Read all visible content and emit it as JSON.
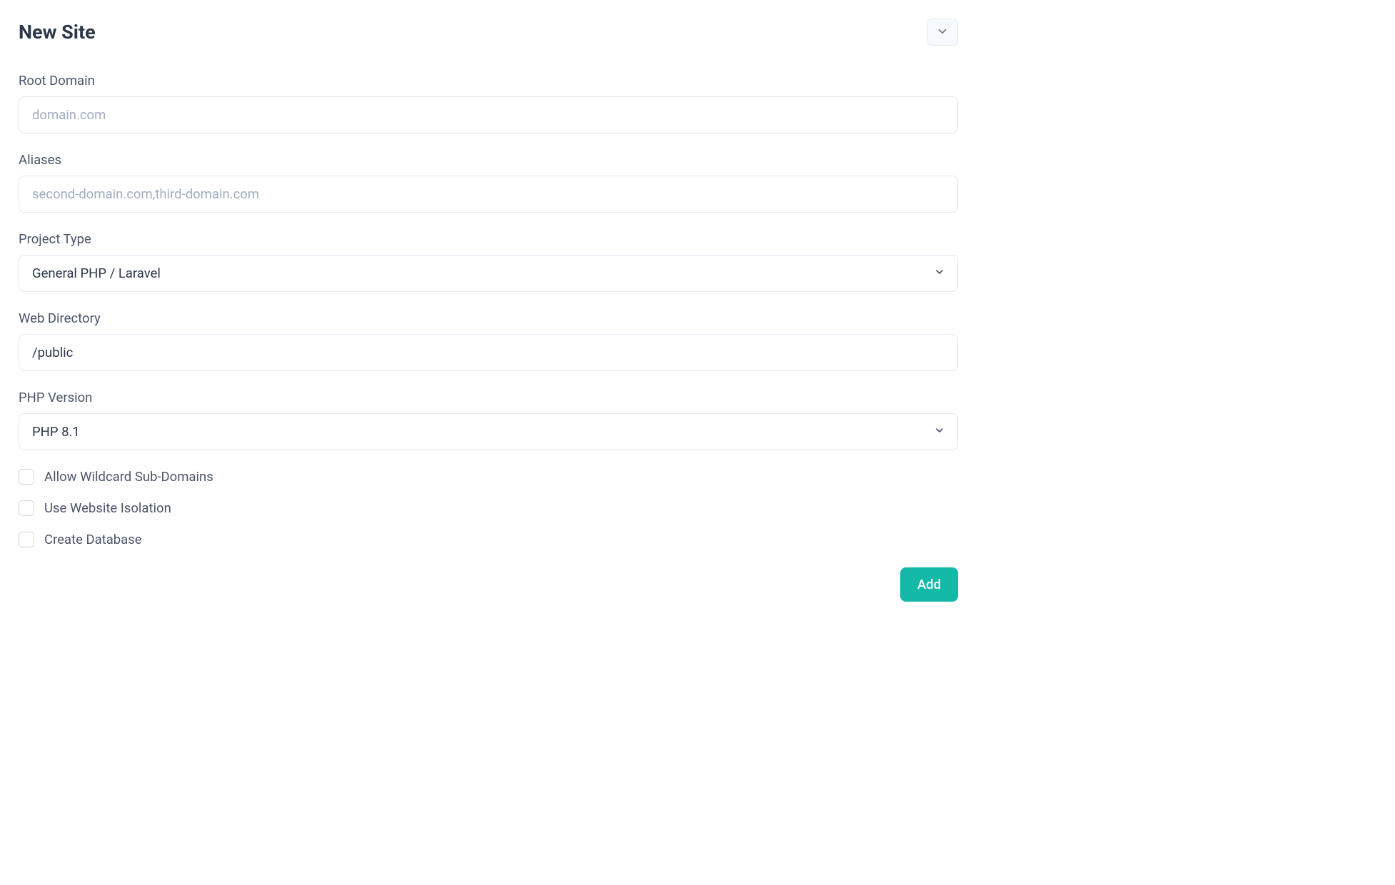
{
  "header": {
    "title": "New Site"
  },
  "form": {
    "root_domain": {
      "label": "Root Domain",
      "placeholder": "domain.com",
      "value": ""
    },
    "aliases": {
      "label": "Aliases",
      "placeholder": "second-domain.com,third-domain.com",
      "value": ""
    },
    "project_type": {
      "label": "Project Type",
      "selected": "General PHP / Laravel"
    },
    "web_directory": {
      "label": "Web Directory",
      "value": "/public"
    },
    "php_version": {
      "label": "PHP Version",
      "selected": "PHP 8.1"
    },
    "checkboxes": {
      "wildcard": {
        "label": "Allow Wildcard Sub-Domains",
        "checked": false
      },
      "isolation": {
        "label": "Use Website Isolation",
        "checked": false
      },
      "database": {
        "label": "Create Database",
        "checked": false
      }
    }
  },
  "buttons": {
    "add": "Add"
  }
}
